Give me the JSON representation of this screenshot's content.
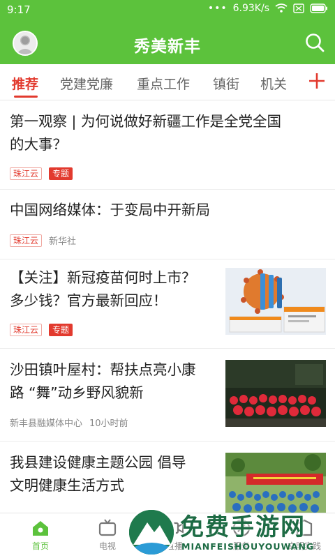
{
  "status": {
    "time": "9:17",
    "dots": "•••",
    "speed": "6.93K/s"
  },
  "header": {
    "title": "秀美新丰",
    "icons": [
      "avatar",
      "search-icon"
    ]
  },
  "tabs": [
    {
      "label": "推荐",
      "active": true
    },
    {
      "label": "党建党廉"
    },
    {
      "label": "重点工作"
    },
    {
      "label": "镇街"
    },
    {
      "label": "机关"
    }
  ],
  "feed": [
    {
      "title_line1": "第一观察 | 为何说做好新疆工作是全党全国",
      "title_line2": "的大事？",
      "source": "珠江云",
      "tag": "专题"
    },
    {
      "title_line1": "中国网络媒体：于变局中开新局",
      "source": "珠江云",
      "publisher": "新华社"
    },
    {
      "title_line1": "【关注】新冠疫苗何时上市？",
      "title_line2": "多少钱？官方最新回应！",
      "source": "珠江云",
      "tag": "专题",
      "thumb": "vaccine"
    },
    {
      "title_line1": "沙田镇叶屋村：帮扶点亮小康",
      "title_line2": "路 “舞”动乡野风貌新",
      "publisher": "新丰县融媒体中心",
      "time": "10小时前",
      "thumb": "dance-group"
    },
    {
      "title_line1": "我县建设健康主题公园 倡导",
      "title_line2": "文明健康生活方式",
      "thumb": "park-crowd"
    }
  ],
  "bottom_nav": [
    {
      "label": "首页",
      "icon": "home-icon",
      "active": true
    },
    {
      "label": "电视",
      "icon": "tv-icon"
    },
    {
      "label": "直播",
      "icon": "live-icon"
    },
    {
      "label": "服务",
      "icon": "service-icon"
    },
    {
      "label": "文明实践",
      "icon": "practice-icon"
    }
  ],
  "watermark": {
    "text": "免费手游网",
    "sub": "MIANFEISHOUYOUWANG"
  },
  "colors": {
    "brand_green": "#5cc23c",
    "accent_red": "#e23a2e"
  }
}
